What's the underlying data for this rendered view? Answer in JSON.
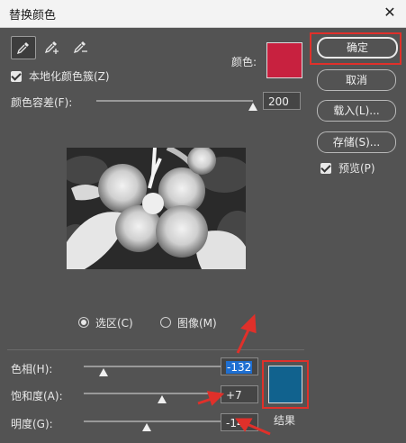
{
  "window": {
    "title": "替换颜色",
    "close_glyph": "✕"
  },
  "tools": [
    "eyedropper-icon",
    "eyedropper-plus-icon",
    "eyedropper-minus-icon"
  ],
  "localized": {
    "label": "本地化颜色簇(Z)",
    "checked": true
  },
  "color": {
    "label": "颜色:",
    "swatch": "#c8213f"
  },
  "tolerance": {
    "label": "颜色容差(F):",
    "value": "200",
    "level": 200,
    "max": 200
  },
  "buttons": {
    "ok": "确定",
    "cancel": "取消",
    "load": "载入(L)...",
    "save": "存储(S)..."
  },
  "preview": {
    "label": "预览(P)",
    "checked": true
  },
  "view_mode": {
    "selection": "选区(C)",
    "image": "图像(M)",
    "selected": "selection"
  },
  "adjust": {
    "hue": {
      "label": "色相(H):",
      "value": "-132",
      "level": -132,
      "min": -180,
      "max": 180
    },
    "saturation": {
      "label": "饱和度(A):",
      "value": "+7",
      "level": 7,
      "min": -100,
      "max": 100
    },
    "lightness": {
      "label": "明度(G):",
      "value": "-14",
      "level": -14,
      "min": -100,
      "max": 100
    }
  },
  "result": {
    "label": "结果",
    "swatch": "#11628e"
  },
  "accent_colors": {
    "highlight": "#e0302a",
    "selection": "#1f6fd1"
  }
}
